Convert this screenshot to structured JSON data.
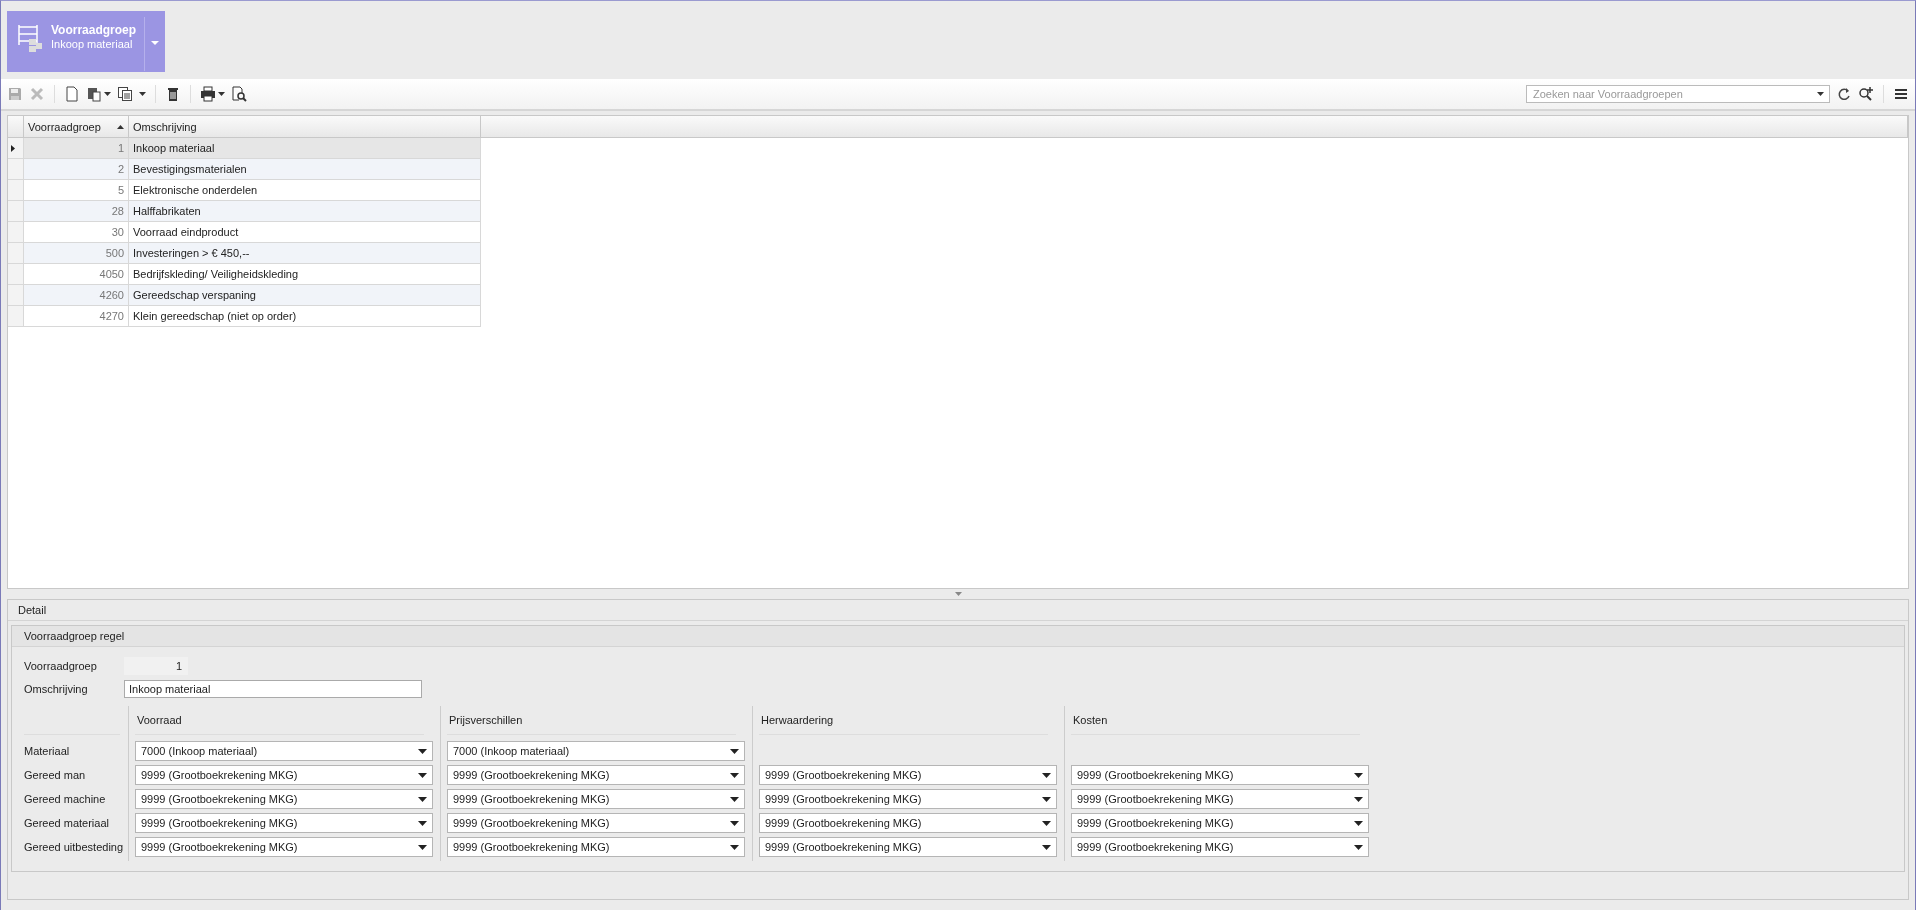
{
  "module_tile": {
    "title": "Voorraadgroep",
    "subtitle": "Inkoop materiaal"
  },
  "search": {
    "placeholder": "Zoeken naar Voorraadgroepen"
  },
  "table": {
    "columns": [
      "Voorraadgroep",
      "Omschrijving"
    ],
    "sort_ascending": true,
    "rows": [
      {
        "code": "1",
        "description": "Inkoop materiaal",
        "selected": true
      },
      {
        "code": "2",
        "description": "Bevestigingsmaterialen",
        "selected": false
      },
      {
        "code": "5",
        "description": "Elektronische onderdelen",
        "selected": false
      },
      {
        "code": "28",
        "description": "Halffabrikaten",
        "selected": false
      },
      {
        "code": "30",
        "description": "Voorraad eindproduct",
        "selected": false
      },
      {
        "code": "500",
        "description": "Investeringen > € 450,--",
        "selected": false
      },
      {
        "code": "4050",
        "description": "Bedrijfskleding/ Veiligheidskleding",
        "selected": false
      },
      {
        "code": "4260",
        "description": "Gereedschap verspaning",
        "selected": false
      },
      {
        "code": "4270",
        "description": "Klein gereedschap (niet op order)",
        "selected": false
      }
    ]
  },
  "detail": {
    "title": "Detail",
    "group_title": "Voorraadgroep regel",
    "fields": [
      {
        "label": "Voorraadgroep",
        "value": "1",
        "kind": "readonly"
      },
      {
        "label": "Omschrijving",
        "value": "Inkoop materiaal",
        "kind": "text"
      }
    ],
    "matrix": {
      "columns": [
        "Voorraad",
        "Prijsverschillen",
        "Herwaardering",
        "Kosten"
      ],
      "rows": [
        {
          "label": "Materiaal",
          "cells": [
            "7000 (Inkoop materiaal)",
            "7000 (Inkoop materiaal)"
          ]
        },
        {
          "label": "Gereed man",
          "cells": [
            "9999 (Grootboekrekening MKG)",
            "9999 (Grootboekrekening MKG)",
            "9999 (Grootboekrekening MKG)",
            "9999 (Grootboekrekening MKG)"
          ]
        },
        {
          "label": "Gereed machine",
          "cells": [
            "9999 (Grootboekrekening MKG)",
            "9999 (Grootboekrekening MKG)",
            "9999 (Grootboekrekening MKG)",
            "9999 (Grootboekrekening MKG)"
          ]
        },
        {
          "label": "Gereed materiaal",
          "cells": [
            "9999 (Grootboekrekening MKG)",
            "9999 (Grootboekrekening MKG)",
            "9999 (Grootboekrekening MKG)",
            "9999 (Grootboekrekening MKG)"
          ]
        },
        {
          "label": "Gereed uitbesteding",
          "cells": [
            "9999 (Grootboekrekening MKG)",
            "9999 (Grootboekrekening MKG)",
            "9999 (Grootboekrekening MKG)",
            "9999 (Grootboekrekening MKG)"
          ]
        }
      ]
    }
  }
}
